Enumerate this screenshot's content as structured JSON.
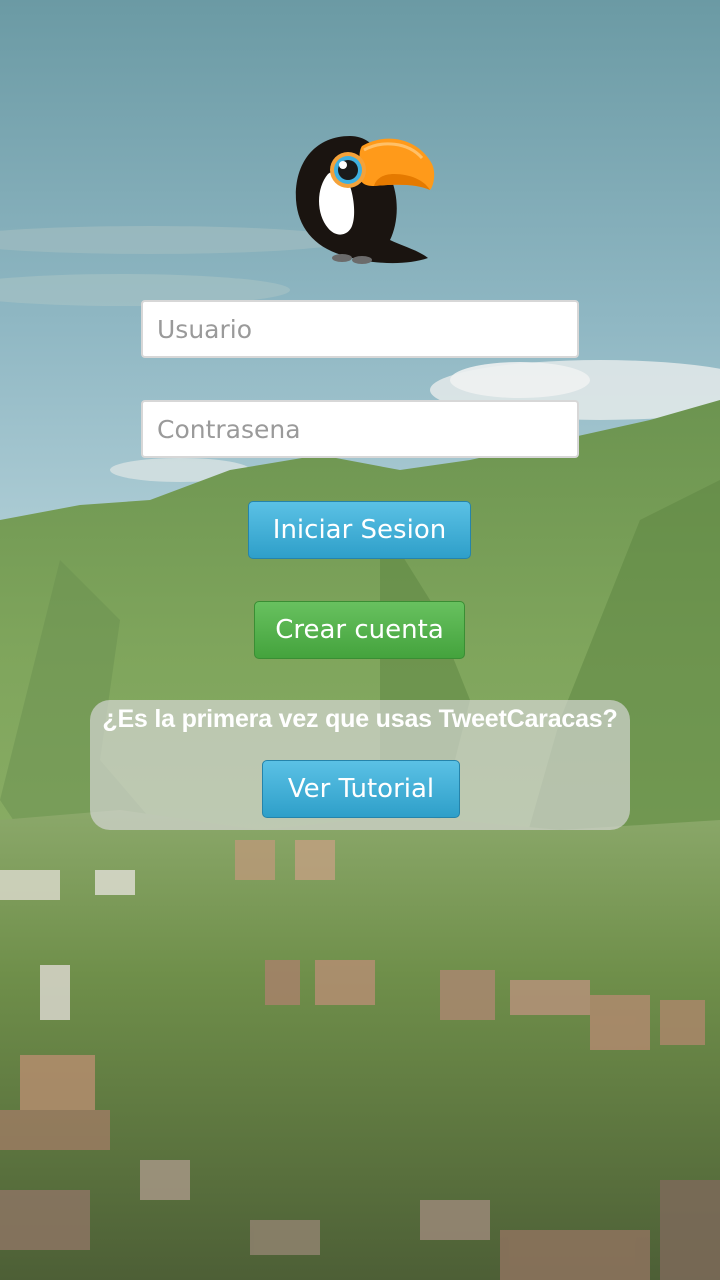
{
  "login": {
    "username_placeholder": "Usuario",
    "password_placeholder": "Contrasena",
    "login_button": "Iniciar Sesion",
    "signup_button": "Crear cuenta"
  },
  "tutorial": {
    "question": "¿Es la primera vez que usas TweetCaracas?",
    "button": "Ver Tutorial"
  },
  "colors": {
    "blue_button": "#3aa9d2",
    "green_button": "#52b04a",
    "panel": "#d7d7d7"
  },
  "icons": {
    "logo": "toucan-icon"
  }
}
